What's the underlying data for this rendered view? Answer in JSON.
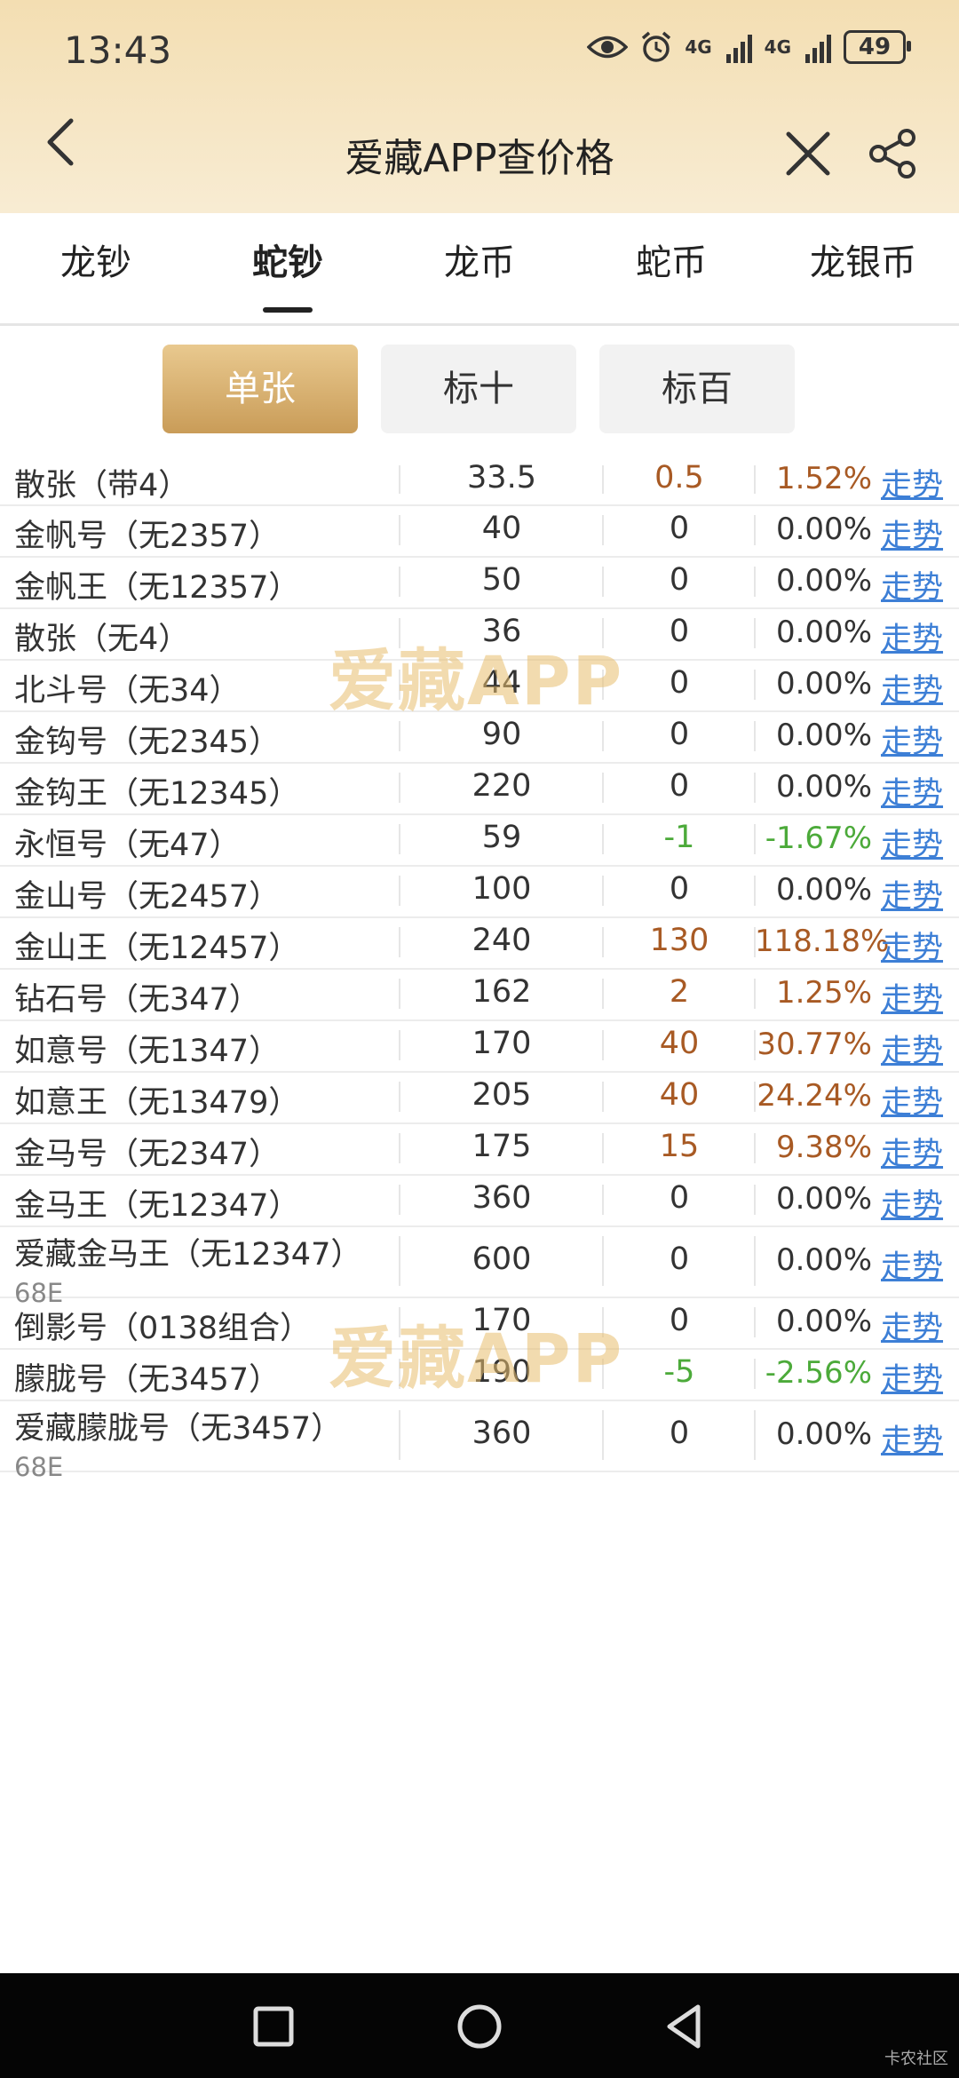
{
  "status_bar": {
    "time": "13:43",
    "net1": "4G",
    "net2": "4G",
    "battery": "49"
  },
  "header": {
    "title": "爱藏APP查价格"
  },
  "tabs": [
    {
      "label": "龙钞",
      "active": false
    },
    {
      "label": "蛇钞",
      "active": true
    },
    {
      "label": "龙币",
      "active": false
    },
    {
      "label": "蛇币",
      "active": false
    },
    {
      "label": "龙银币",
      "active": false
    }
  ],
  "segments": [
    {
      "label": "单张",
      "active": true
    },
    {
      "label": "标十",
      "active": false
    },
    {
      "label": "标百",
      "active": false
    }
  ],
  "watermark_text": "爱藏APP",
  "rows": [
    {
      "name": "散张（带4）",
      "sub": "",
      "price": "33.5",
      "change": "0.5",
      "pct": "1.52%",
      "trend": "走势",
      "dir": "up"
    },
    {
      "name": "金帆号（无2357）",
      "sub": "",
      "price": "40",
      "change": "0",
      "pct": "0.00%",
      "trend": "走势",
      "dir": "flat"
    },
    {
      "name": "金帆王（无12357）",
      "sub": "",
      "price": "50",
      "change": "0",
      "pct": "0.00%",
      "trend": "走势",
      "dir": "flat"
    },
    {
      "name": "散张（无4）",
      "sub": "",
      "price": "36",
      "change": "0",
      "pct": "0.00%",
      "trend": "走势",
      "dir": "flat"
    },
    {
      "name": "北斗号（无34）",
      "sub": "",
      "price": "44",
      "change": "0",
      "pct": "0.00%",
      "trend": "走势",
      "dir": "flat"
    },
    {
      "name": "金钩号（无2345）",
      "sub": "",
      "price": "90",
      "change": "0",
      "pct": "0.00%",
      "trend": "走势",
      "dir": "flat"
    },
    {
      "name": "金钩王（无12345）",
      "sub": "",
      "price": "220",
      "change": "0",
      "pct": "0.00%",
      "trend": "走势",
      "dir": "flat"
    },
    {
      "name": "永恒号（无47）",
      "sub": "",
      "price": "59",
      "change": "-1",
      "pct": "-1.67%",
      "trend": "走势",
      "dir": "down"
    },
    {
      "name": "金山号（无2457）",
      "sub": "",
      "price": "100",
      "change": "0",
      "pct": "0.00%",
      "trend": "走势",
      "dir": "flat"
    },
    {
      "name": "金山王（无12457）",
      "sub": "",
      "price": "240",
      "change": "130",
      "pct": "118.18%",
      "trend": "走势",
      "dir": "up"
    },
    {
      "name": "钻石号（无347）",
      "sub": "",
      "price": "162",
      "change": "2",
      "pct": "1.25%",
      "trend": "走势",
      "dir": "up"
    },
    {
      "name": "如意号（无1347）",
      "sub": "",
      "price": "170",
      "change": "40",
      "pct": "30.77%",
      "trend": "走势",
      "dir": "up"
    },
    {
      "name": "如意王（无13479）",
      "sub": "",
      "price": "205",
      "change": "40",
      "pct": "24.24%",
      "trend": "走势",
      "dir": "up"
    },
    {
      "name": "金马号（无2347）",
      "sub": "",
      "price": "175",
      "change": "15",
      "pct": "9.38%",
      "trend": "走势",
      "dir": "up"
    },
    {
      "name": "金马王（无12347）",
      "sub": "",
      "price": "360",
      "change": "0",
      "pct": "0.00%",
      "trend": "走势",
      "dir": "flat"
    },
    {
      "name": "爱藏金马王（无12347）",
      "sub": "68E",
      "price": "600",
      "change": "0",
      "pct": "0.00%",
      "trend": "走势",
      "dir": "flat"
    },
    {
      "name": "倒影号（0138组合）",
      "sub": "",
      "price": "170",
      "change": "0",
      "pct": "0.00%",
      "trend": "走势",
      "dir": "flat"
    },
    {
      "name": "朦胧号（无3457）",
      "sub": "",
      "price": "190",
      "change": "-5",
      "pct": "-2.56%",
      "trend": "走势",
      "dir": "down"
    },
    {
      "name": "爱藏朦胧号（无3457）",
      "sub": "68E",
      "price": "360",
      "change": "0",
      "pct": "0.00%",
      "trend": "走势",
      "dir": "flat"
    }
  ],
  "footer_caption": "卡农社区"
}
